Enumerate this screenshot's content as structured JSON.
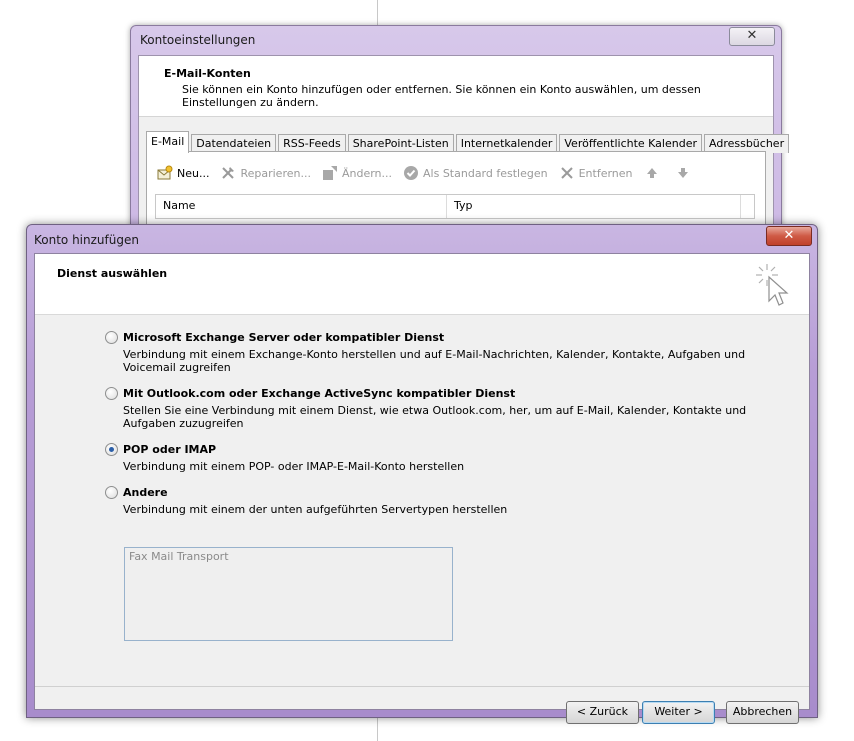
{
  "back_window": {
    "title": "Kontoeinstellungen",
    "close_glyph": "✕",
    "header_title": "E-Mail-Konten",
    "header_desc": "Sie können ein Konto hinzufügen oder entfernen. Sie können ein Konto auswählen, um dessen Einstellungen zu ändern.",
    "tabs": [
      "E-Mail",
      "Datendateien",
      "RSS-Feeds",
      "SharePoint-Listen",
      "Internetkalender",
      "Veröffentlichte Kalender",
      "Adressbücher"
    ],
    "toolbar": {
      "new": "Neu...",
      "repair": "Reparieren...",
      "change": "Ändern...",
      "set_default": "Als Standard festlegen",
      "remove": "Entfernen"
    },
    "list_columns": [
      "Name",
      "Typ"
    ]
  },
  "front_window": {
    "title": "Konto hinzufügen",
    "close_glyph": "✕",
    "header_title": "Dienst auswählen",
    "options": [
      {
        "label": "Microsoft Exchange Server oder kompatibler Dienst",
        "desc": "Verbindung mit einem Exchange-Konto herstellen und auf E-Mail-Nachrichten, Kalender, Kontakte, Aufgaben und Voicemail zugreifen",
        "checked": false
      },
      {
        "label": "Mit Outlook.com oder Exchange ActiveSync kompatibler Dienst",
        "desc": "Stellen Sie eine Verbindung mit einem Dienst, wie etwa Outlook.com, her, um auf E-Mail, Kalender, Kontakte und Aufgaben zuzugreifen",
        "checked": false
      },
      {
        "label": "POP oder IMAP",
        "desc": "Verbindung mit einem POP- oder IMAP-E-Mail-Konto herstellen",
        "checked": true
      },
      {
        "label": "Andere",
        "desc": "Verbindung mit einem der unten aufgeführten Servertypen herstellen",
        "checked": false
      }
    ],
    "server_types": [
      "Fax Mail Transport"
    ],
    "buttons": {
      "back": "< Zurück",
      "next": "Weiter >",
      "cancel": "Abbrechen"
    }
  }
}
